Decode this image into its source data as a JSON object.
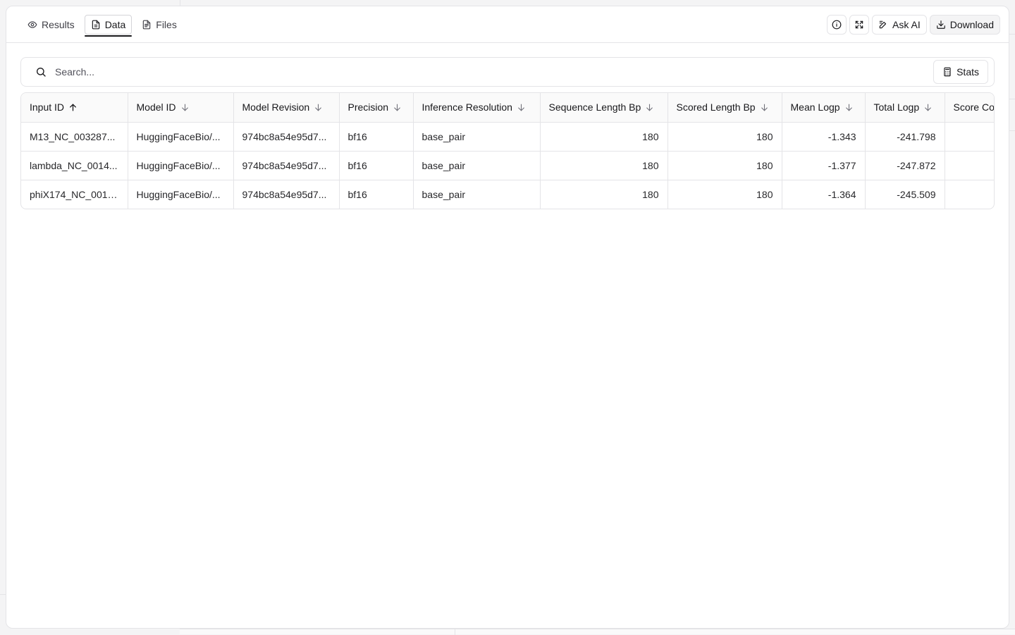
{
  "tabs": [
    {
      "label": "Results",
      "icon": "eye-icon"
    },
    {
      "label": "Data",
      "icon": "file-icon",
      "active": true
    },
    {
      "label": "Files",
      "icon": "file-text-icon"
    }
  ],
  "actions": {
    "info_icon": "info-icon",
    "expand_icon": "expand-icon",
    "ask_ai_label": "Ask AI",
    "download_label": "Download"
  },
  "search": {
    "placeholder": "Search...",
    "stats_label": "Stats"
  },
  "table": {
    "columns": [
      {
        "label": "Input ID",
        "sort": "asc"
      },
      {
        "label": "Model ID",
        "sort": "none"
      },
      {
        "label": "Model Revision",
        "sort": "none"
      },
      {
        "label": "Precision",
        "sort": "none"
      },
      {
        "label": "Inference Resolution",
        "sort": "none"
      },
      {
        "label": "Sequence Length Bp",
        "sort": "none"
      },
      {
        "label": "Scored Length Bp",
        "sort": "none"
      },
      {
        "label": "Mean Logp",
        "sort": "none"
      },
      {
        "label": "Total Logp",
        "sort": "none"
      },
      {
        "label": "Score Co",
        "sort": "none"
      }
    ],
    "rows": [
      [
        "M13_NC_003287...",
        "HuggingFaceBio/...",
        "974bc8a54e95d7...",
        "bf16",
        "base_pair",
        "180",
        "180",
        "-1.343",
        "-241.798",
        ""
      ],
      [
        "lambda_NC_0014...",
        "HuggingFaceBio/...",
        "974bc8a54e95d7...",
        "bf16",
        "base_pair",
        "180",
        "180",
        "-1.377",
        "-247.872",
        ""
      ],
      [
        "phiX174_NC_0014...",
        "HuggingFaceBio/...",
        "974bc8a54e95d7...",
        "bf16",
        "base_pair",
        "180",
        "180",
        "-1.364",
        "-245.509",
        ""
      ]
    ]
  }
}
